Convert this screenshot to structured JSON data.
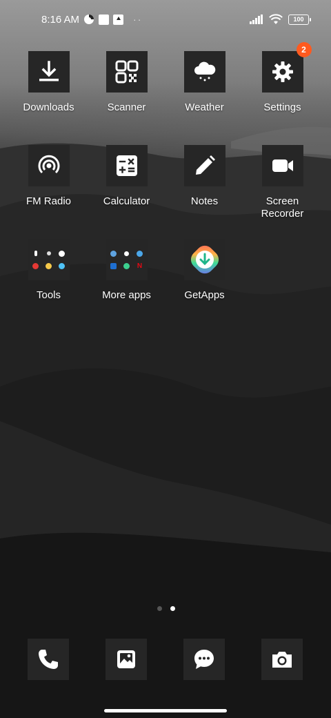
{
  "status_bar": {
    "time": "8:16 AM",
    "overflow": "··",
    "battery": "100",
    "icons": [
      "data-saver-icon",
      "notification-square-icon",
      "upload-icon",
      "signal-icon",
      "wifi-icon",
      "battery-icon"
    ]
  },
  "apps": [
    {
      "label": "Downloads",
      "icon": "download-icon"
    },
    {
      "label": "Scanner",
      "icon": "qr-scanner-icon"
    },
    {
      "label": "Weather",
      "icon": "weather-cloud-icon"
    },
    {
      "label": "Settings",
      "icon": "gear-icon",
      "badge": "2"
    },
    {
      "label": "FM Radio",
      "icon": "radio-icon"
    },
    {
      "label": "Calculator",
      "icon": "calculator-icon"
    },
    {
      "label": "Notes",
      "icon": "pencil-icon"
    },
    {
      "label": "Screen Recorder",
      "icon": "video-camera-icon"
    },
    {
      "label": "Tools",
      "icon": "folder-icon"
    },
    {
      "label": "More apps",
      "icon": "folder-icon"
    },
    {
      "label": "GetApps",
      "icon": "getapps-icon"
    }
  ],
  "colors": {
    "badge": "#ff5a1f",
    "tile": "#262626"
  },
  "page_indicator": {
    "pages": 2,
    "active": 2
  },
  "dock": [
    {
      "icon": "phone-icon"
    },
    {
      "icon": "gallery-icon"
    },
    {
      "icon": "messages-icon"
    },
    {
      "icon": "camera-icon"
    }
  ]
}
